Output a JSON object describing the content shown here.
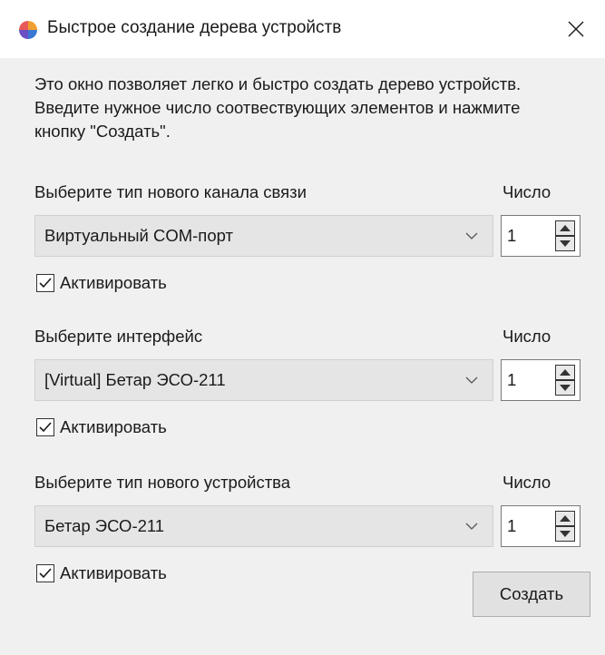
{
  "window": {
    "title": "Быстрое создание дерева устройств"
  },
  "description": "Это окно позволяет легко и быстро создать дерево устройств. Введите нужное число соотвествующих элементов и нажмите кнопку \"Создать\".",
  "sections": [
    {
      "label": "Выберите тип нового канала связи",
      "count_label": "Число",
      "selected": "Виртуальный COM-порт",
      "count": "1",
      "activate_label": "Активировать",
      "activate_checked": true
    },
    {
      "label": "Выберите интерфейс",
      "count_label": "Число",
      "selected": "[Virtual] Бетар ЭСО-211",
      "count": "1",
      "activate_label": "Активировать",
      "activate_checked": true
    },
    {
      "label": "Выберите тип нового устройства",
      "count_label": "Число",
      "selected": "Бетар ЭСО-211",
      "count": "1",
      "activate_label": "Активировать",
      "activate_checked": true
    }
  ],
  "create_button_label": "Создать",
  "icons": {
    "app": "app-logo-icon",
    "close": "close-icon",
    "dropdown": "chevron-down-icon",
    "spinner": "spinner-arrows-icon",
    "check": "checkmark-icon"
  }
}
